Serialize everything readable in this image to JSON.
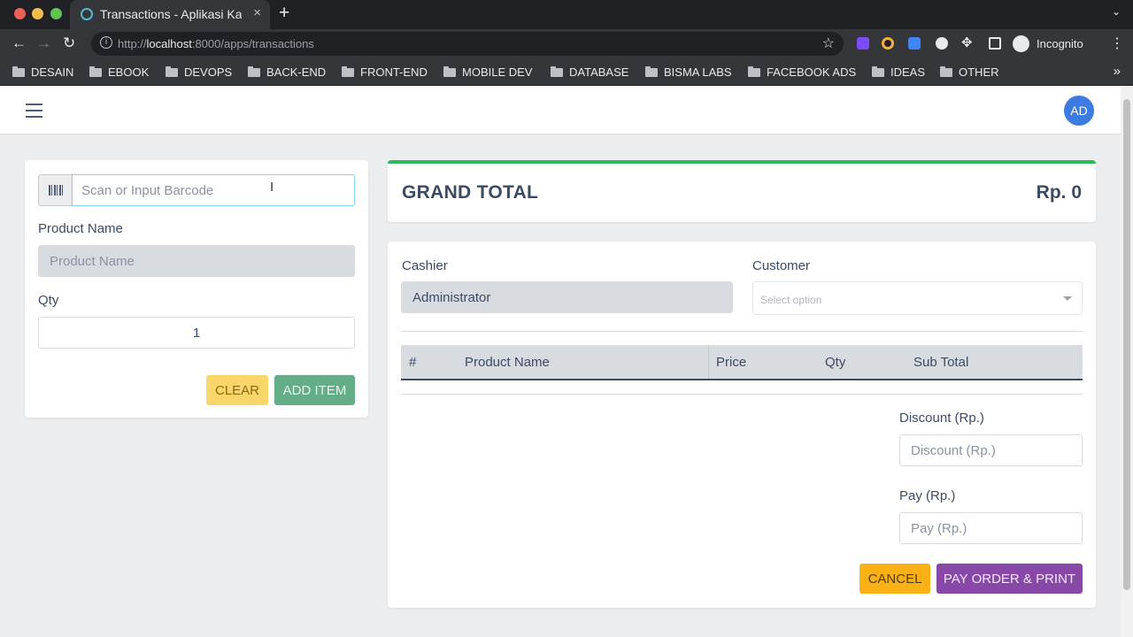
{
  "browser": {
    "tab_title": "Transactions - Aplikasi Kasir",
    "tab_close": "×",
    "new_tab": "+",
    "url_prefix": "http://",
    "url_host": "localhost",
    "url_rest": ":8000/apps/transactions",
    "info_glyph": "i",
    "star_glyph": "☆",
    "profile_label": "Incognito",
    "menu_glyph": "⋮",
    "tab_search_glyph": "⌄",
    "bookmarks": [
      "DESAIN",
      "EBOOK",
      "DEVOPS",
      "BACK-END",
      "FRONT-END",
      "MOBILE DEV",
      "DATABASE",
      "BISMA LABS",
      "FACEBOOK ADS",
      "IDEAS",
      "OTHER"
    ],
    "bookmarks_more": "»",
    "icons": {
      "back": "back-arrow-icon",
      "forward": "forward-arrow-icon",
      "reload": "reload-icon",
      "extensions": "puzzle-icon"
    }
  },
  "header": {
    "avatar_initials": "AD"
  },
  "left_form": {
    "barcode_placeholder": "Scan or Input Barcode",
    "product_name_label": "Product Name",
    "product_name_placeholder": "Product Name",
    "qty_label": "Qty",
    "qty_value": "1",
    "clear_label": "CLEAR",
    "add_item_label": "ADD ITEM"
  },
  "grand_total": {
    "label": "GRAND TOTAL",
    "value": "Rp. 0"
  },
  "transaction": {
    "cashier_label": "Cashier",
    "cashier_value": "Administrator",
    "customer_label": "Customer",
    "customer_placeholder": "Select option",
    "table_headers": [
      "#",
      "Product Name",
      "Price",
      "Qty",
      "Sub Total"
    ],
    "table_rows": [],
    "discount_label": "Discount (Rp.)",
    "discount_placeholder": "Discount (Rp.)",
    "pay_label": "Pay (Rp.)",
    "pay_placeholder": "Pay (Rp.)",
    "cancel_label": "CANCEL",
    "pay_order_label": "PAY ORDER & PRINT"
  },
  "colors": {
    "success": "#2eb85c",
    "warning": "#f9b115",
    "purple": "#8748a8",
    "avatar": "#3c7be0"
  }
}
